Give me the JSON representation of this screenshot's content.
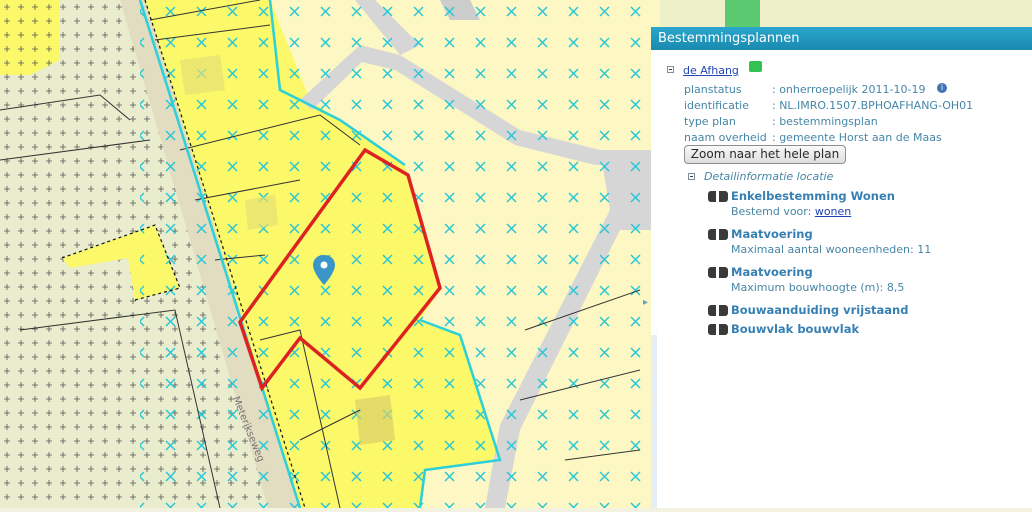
{
  "panel": {
    "title": "Bestemmingsplannen",
    "plan_link": "de Afhang",
    "fields": [
      {
        "label": "planstatus",
        "value": ": onherroepelijk 2011-10-19"
      },
      {
        "label": "identificatie",
        "value": ": NL.IMRO.1507.BPHOAFHANG-OH01"
      },
      {
        "label": "type plan",
        "value": ": bestemmingsplan"
      },
      {
        "label": "naam overheid",
        "value": ": gemeente Horst aan de Maas"
      }
    ],
    "zoom_button": "Zoom naar het hele plan",
    "detail_header": "Detailinformatie locatie",
    "details": [
      {
        "title": "Enkelbestemming Wonen",
        "line_prefix": "Bestemd voor: ",
        "line_link": "wonen",
        "line": ""
      },
      {
        "title": "Maatvoering",
        "line_prefix": "",
        "line_link": "",
        "line": "Maximaal aantal wooneenheden: 11"
      },
      {
        "title": "Maatvoering",
        "line_prefix": "",
        "line_link": "",
        "line": "Maximum bouwhoogte (m): 8,5"
      },
      {
        "title": "Bouwaanduiding vrijstaand",
        "line_prefix": "",
        "line_link": "",
        "line": ""
      },
      {
        "title": "Bouwvlak bouwvlak",
        "line_prefix": "",
        "line_link": "",
        "line": ""
      }
    ]
  },
  "map": {
    "street_label": "Meterikseweg",
    "colors": {
      "wonen": "#fbf86a",
      "tuin": "#fcf7c3",
      "road": "#d8d8d8",
      "agrarisch": "#eef0c8",
      "boundary": "#2bd0d8",
      "selection": "#dd2222",
      "marker": "#3b96c8"
    }
  }
}
